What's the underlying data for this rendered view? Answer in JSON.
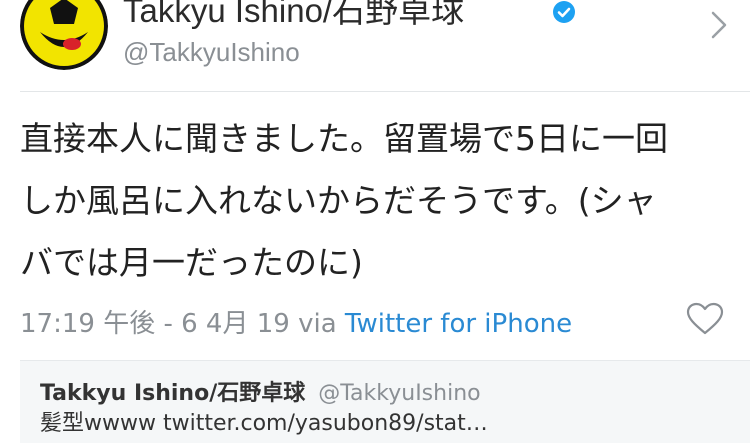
{
  "header": {
    "display_name": "Takkyu Ishino/石野卓球",
    "handle": "@TakkyuIshino",
    "icons": [
      "avatar-smiley-icon",
      "verified-badge-icon",
      "chevron-right-icon"
    ]
  },
  "tweet": {
    "text_lines": [
      "直接本人に聞きました。留置場で5日に一回",
      "しか風呂に入れないからだそうです。(シャ",
      "バでは月一だったのに)"
    ],
    "timestamp": "17:19 午後 - 6 4月 19",
    "via": "via",
    "source": "Twitter for iPhone",
    "like_icon": "heart-icon"
  },
  "quoted": {
    "name": "Takkyu Ishino/石野卓球",
    "handle": "@TakkyuIshino",
    "text": "髪型wwww twitter.com/yasubon89/stat…"
  },
  "colors": {
    "link": "#2a8ad3",
    "verified": "#1da1f2",
    "muted": "#8a8f94",
    "avatar_yellow": "#f2e400"
  }
}
